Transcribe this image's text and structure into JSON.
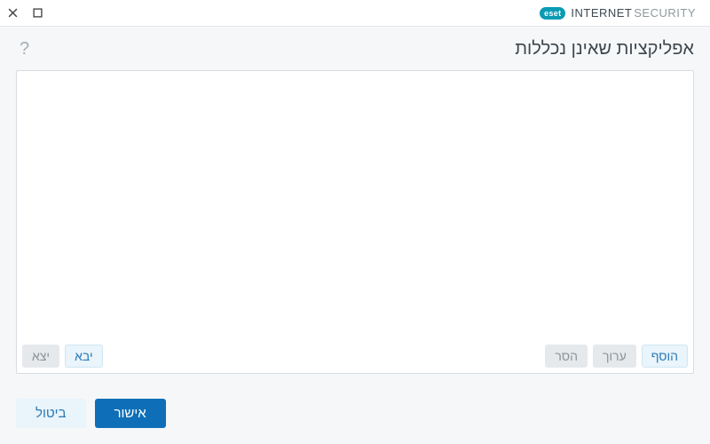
{
  "brand": {
    "badge": "eset",
    "name1": "INTERNET",
    "name2": "SECURITY"
  },
  "page": {
    "title": "אפליקציות שאינן נכללות"
  },
  "actions": {
    "add": "הוסף",
    "edit": "ערוך",
    "remove": "הסר",
    "import": "יבא",
    "export": "יצא"
  },
  "footer": {
    "ok": "אישור",
    "cancel": "ביטול"
  },
  "list": {
    "items": []
  }
}
